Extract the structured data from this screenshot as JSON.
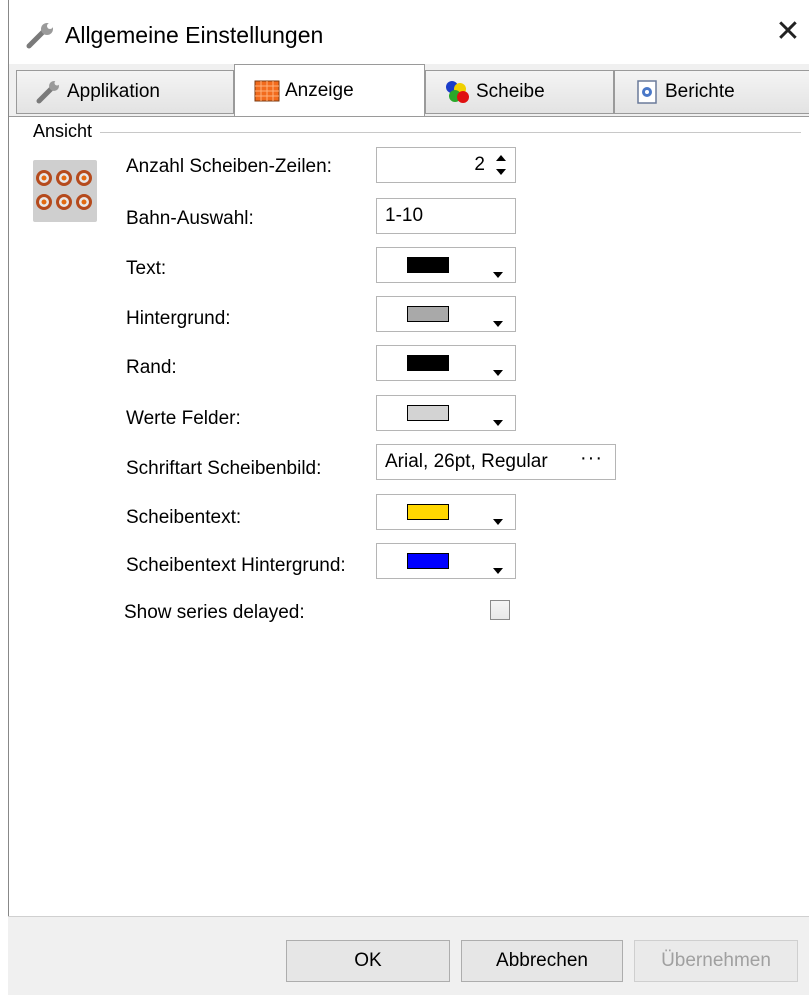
{
  "window": {
    "title": "Allgemeine Einstellungen",
    "close_glyph": "✕",
    "title_icon": "wrench-icon"
  },
  "tabs": [
    {
      "label": "Applikation",
      "icon": "wrench-icon",
      "active": false
    },
    {
      "label": "Anzeige",
      "icon": "display-grid-icon",
      "active": true
    },
    {
      "label": "Scheibe",
      "icon": "colored-circles-icon",
      "active": false
    },
    {
      "label": "Berichte",
      "icon": "report-icon",
      "active": false
    }
  ],
  "group": {
    "label": "Ansicht",
    "icon": "targets-grid-icon"
  },
  "fields": {
    "rows": {
      "label": "Anzahl Scheiben-Zeilen:",
      "value": "2"
    },
    "lane": {
      "label": "Bahn-Auswahl:",
      "value": "1-10"
    },
    "text": {
      "label": "Text:",
      "color": "#000000"
    },
    "background": {
      "label": "Hintergrund:",
      "color": "#a9a9a9"
    },
    "border": {
      "label": "Rand:",
      "color": "#000000"
    },
    "value_fields": {
      "label": "Werte Felder:",
      "color": "#d3d3d3"
    },
    "font": {
      "label": "Schriftart Scheibenbild:",
      "value": "Arial, 26pt, Regular",
      "button": "···"
    },
    "target_text": {
      "label": "Scheibentext:",
      "color": "#ffd700"
    },
    "target_text_bg": {
      "label": "Scheibentext Hintergrund:",
      "color": "#0000ff"
    },
    "show_delayed": {
      "label": "Show series delayed:",
      "checked": false
    }
  },
  "buttons": {
    "ok": "OK",
    "cancel": "Abbrechen",
    "apply": "Übernehmen"
  }
}
